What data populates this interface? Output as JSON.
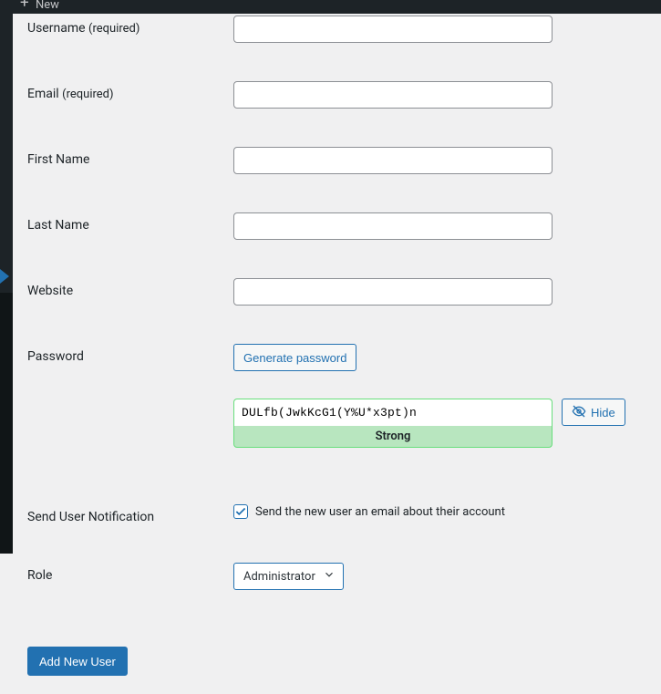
{
  "topbar": {
    "new_label": "New"
  },
  "labels": {
    "username": "Username",
    "email": "Email",
    "required_suffix": "(required)",
    "first_name": "First Name",
    "last_name": "Last Name",
    "website": "Website",
    "password": "Password",
    "send_notification": "Send User Notification",
    "role": "Role"
  },
  "fields": {
    "username": "",
    "email": "",
    "first_name": "",
    "last_name": "",
    "website": "",
    "password_value": "DULfb(JwkKcG1(Y%U*x3pt)n",
    "notification_checked": true,
    "role_selected": "Administrator"
  },
  "buttons": {
    "generate_password": "Generate password",
    "hide": "Hide",
    "submit": "Add New User"
  },
  "password_strength": "Strong",
  "notification_text": "Send the new user an email about their account",
  "colors": {
    "primary": "#2271b1",
    "strength_bg": "#b8e6bf",
    "strength_border": "#68de7c"
  }
}
